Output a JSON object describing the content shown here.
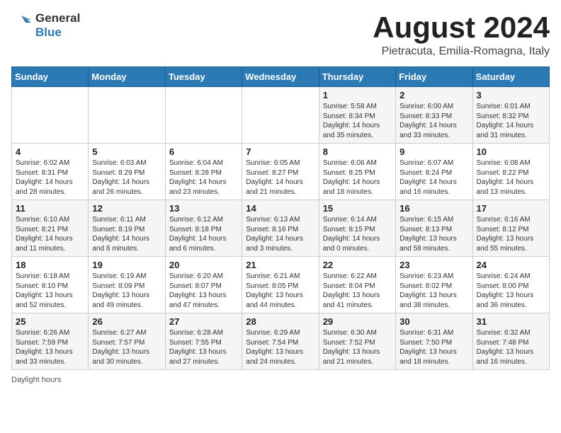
{
  "header": {
    "logo_general": "General",
    "logo_blue": "Blue",
    "title": "August 2024",
    "location": "Pietracuta, Emilia-Romagna, Italy"
  },
  "calendar": {
    "days_of_week": [
      "Sunday",
      "Monday",
      "Tuesday",
      "Wednesday",
      "Thursday",
      "Friday",
      "Saturday"
    ],
    "weeks": [
      [
        {
          "day": "",
          "info": ""
        },
        {
          "day": "",
          "info": ""
        },
        {
          "day": "",
          "info": ""
        },
        {
          "day": "",
          "info": ""
        },
        {
          "day": "1",
          "info": "Sunrise: 5:58 AM\nSunset: 8:34 PM\nDaylight: 14 hours and 35 minutes."
        },
        {
          "day": "2",
          "info": "Sunrise: 6:00 AM\nSunset: 8:33 PM\nDaylight: 14 hours and 33 minutes."
        },
        {
          "day": "3",
          "info": "Sunrise: 6:01 AM\nSunset: 8:32 PM\nDaylight: 14 hours and 31 minutes."
        }
      ],
      [
        {
          "day": "4",
          "info": "Sunrise: 6:02 AM\nSunset: 8:31 PM\nDaylight: 14 hours and 28 minutes."
        },
        {
          "day": "5",
          "info": "Sunrise: 6:03 AM\nSunset: 8:29 PM\nDaylight: 14 hours and 26 minutes."
        },
        {
          "day": "6",
          "info": "Sunrise: 6:04 AM\nSunset: 8:28 PM\nDaylight: 14 hours and 23 minutes."
        },
        {
          "day": "7",
          "info": "Sunrise: 6:05 AM\nSunset: 8:27 PM\nDaylight: 14 hours and 21 minutes."
        },
        {
          "day": "8",
          "info": "Sunrise: 6:06 AM\nSunset: 8:25 PM\nDaylight: 14 hours and 18 minutes."
        },
        {
          "day": "9",
          "info": "Sunrise: 6:07 AM\nSunset: 8:24 PM\nDaylight: 14 hours and 16 minutes."
        },
        {
          "day": "10",
          "info": "Sunrise: 6:08 AM\nSunset: 8:22 PM\nDaylight: 14 hours and 13 minutes."
        }
      ],
      [
        {
          "day": "11",
          "info": "Sunrise: 6:10 AM\nSunset: 8:21 PM\nDaylight: 14 hours and 11 minutes."
        },
        {
          "day": "12",
          "info": "Sunrise: 6:11 AM\nSunset: 8:19 PM\nDaylight: 14 hours and 8 minutes."
        },
        {
          "day": "13",
          "info": "Sunrise: 6:12 AM\nSunset: 8:18 PM\nDaylight: 14 hours and 6 minutes."
        },
        {
          "day": "14",
          "info": "Sunrise: 6:13 AM\nSunset: 8:16 PM\nDaylight: 14 hours and 3 minutes."
        },
        {
          "day": "15",
          "info": "Sunrise: 6:14 AM\nSunset: 8:15 PM\nDaylight: 14 hours and 0 minutes."
        },
        {
          "day": "16",
          "info": "Sunrise: 6:15 AM\nSunset: 8:13 PM\nDaylight: 13 hours and 58 minutes."
        },
        {
          "day": "17",
          "info": "Sunrise: 6:16 AM\nSunset: 8:12 PM\nDaylight: 13 hours and 55 minutes."
        }
      ],
      [
        {
          "day": "18",
          "info": "Sunrise: 6:18 AM\nSunset: 8:10 PM\nDaylight: 13 hours and 52 minutes."
        },
        {
          "day": "19",
          "info": "Sunrise: 6:19 AM\nSunset: 8:09 PM\nDaylight: 13 hours and 49 minutes."
        },
        {
          "day": "20",
          "info": "Sunrise: 6:20 AM\nSunset: 8:07 PM\nDaylight: 13 hours and 47 minutes."
        },
        {
          "day": "21",
          "info": "Sunrise: 6:21 AM\nSunset: 8:05 PM\nDaylight: 13 hours and 44 minutes."
        },
        {
          "day": "22",
          "info": "Sunrise: 6:22 AM\nSunset: 8:04 PM\nDaylight: 13 hours and 41 minutes."
        },
        {
          "day": "23",
          "info": "Sunrise: 6:23 AM\nSunset: 8:02 PM\nDaylight: 13 hours and 38 minutes."
        },
        {
          "day": "24",
          "info": "Sunrise: 6:24 AM\nSunset: 8:00 PM\nDaylight: 13 hours and 36 minutes."
        }
      ],
      [
        {
          "day": "25",
          "info": "Sunrise: 6:26 AM\nSunset: 7:59 PM\nDaylight: 13 hours and 33 minutes."
        },
        {
          "day": "26",
          "info": "Sunrise: 6:27 AM\nSunset: 7:57 PM\nDaylight: 13 hours and 30 minutes."
        },
        {
          "day": "27",
          "info": "Sunrise: 6:28 AM\nSunset: 7:55 PM\nDaylight: 13 hours and 27 minutes."
        },
        {
          "day": "28",
          "info": "Sunrise: 6:29 AM\nSunset: 7:54 PM\nDaylight: 13 hours and 24 minutes."
        },
        {
          "day": "29",
          "info": "Sunrise: 6:30 AM\nSunset: 7:52 PM\nDaylight: 13 hours and 21 minutes."
        },
        {
          "day": "30",
          "info": "Sunrise: 6:31 AM\nSunset: 7:50 PM\nDaylight: 13 hours and 18 minutes."
        },
        {
          "day": "31",
          "info": "Sunrise: 6:32 AM\nSunset: 7:48 PM\nDaylight: 13 hours and 16 minutes."
        }
      ]
    ]
  },
  "footer": {
    "note": "Daylight hours"
  }
}
